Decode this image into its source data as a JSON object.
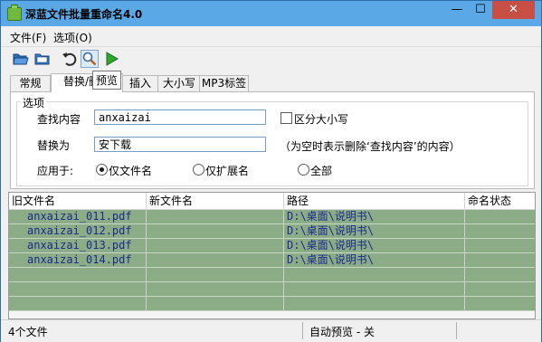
{
  "window": {
    "title": "深蓝文件批量重命名4.0",
    "min": "—",
    "max": "☐",
    "close": "✕"
  },
  "menu": [
    {
      "label": "文件(F)"
    },
    {
      "label": "选项(O)"
    }
  ],
  "toolbar": {
    "tooltip": "预览"
  },
  "tabs": [
    {
      "label": "常规"
    },
    {
      "label": "替换/删除"
    },
    {
      "label": "插入"
    },
    {
      "label": "大小写"
    },
    {
      "label": "MP3标签"
    }
  ],
  "options": {
    "group_title": "选项",
    "find_label": "查找内容",
    "find_value": "anxaizai",
    "case_label": "区分大小写",
    "replace_label": "替换为",
    "replace_value": "安下载",
    "hint": "（为空时表示删除‘查找内容’的内容）",
    "apply_label": "应用于:",
    "apply_options": [
      {
        "label": "仅文件名",
        "selected": true
      },
      {
        "label": "仅扩展名",
        "selected": false
      },
      {
        "label": "全部",
        "selected": false
      }
    ]
  },
  "list": {
    "columns": [
      "旧文件名",
      "新文件名",
      "路径",
      "命名状态"
    ],
    "rows": [
      {
        "old": "anxaizai_011.pdf",
        "new": "",
        "path": "D:\\桌面\\说明书\\",
        "status": ""
      },
      {
        "old": "anxaizai_012.pdf",
        "new": "",
        "path": "D:\\桌面\\说明书\\",
        "status": ""
      },
      {
        "old": "anxaizai_013.pdf",
        "new": "",
        "path": "D:\\桌面\\说明书\\",
        "status": ""
      },
      {
        "old": "anxaizai_014.pdf",
        "new": "",
        "path": "D:\\桌面\\说明书\\",
        "status": ""
      }
    ]
  },
  "status": {
    "count": "4个文件",
    "preview": "自动预览 - 关"
  },
  "colors": {
    "titlebar": "#5aa8e6",
    "row_bg": "#8cac87",
    "row_text": "#1a2a8a",
    "close": "#c94e43"
  },
  "icons": [
    "app-icon",
    "open-folder-icon",
    "folder-icon",
    "undo-icon",
    "magnifier-icon",
    "play-icon"
  ]
}
